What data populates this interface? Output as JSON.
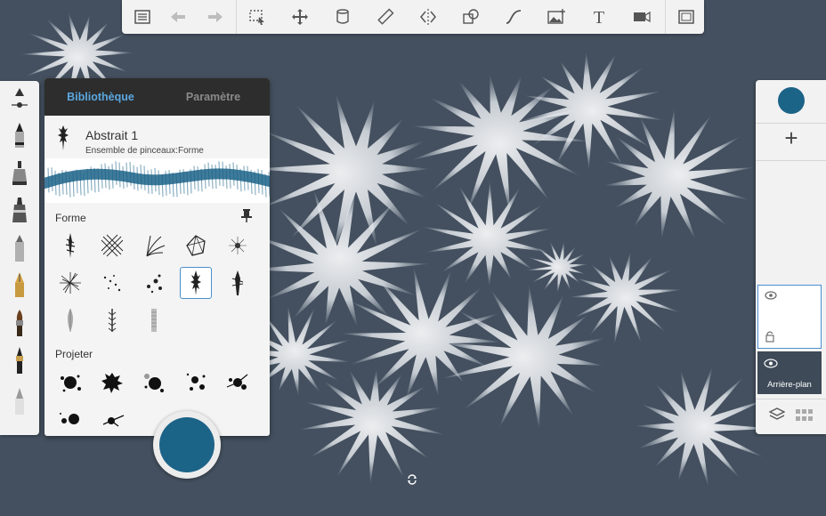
{
  "colors": {
    "canvas_bg": "#44505f",
    "accent_blue": "#1c6388",
    "tab_active": "#5aa7e0",
    "panel_dark": "#2d2d2d",
    "selection": "#4a8fd0"
  },
  "toolbar": {
    "items": [
      {
        "name": "list-icon"
      },
      {
        "name": "undo-icon"
      },
      {
        "name": "redo-icon"
      },
      {
        "name": "selection-icon"
      },
      {
        "name": "transform-icon"
      },
      {
        "name": "fill-bucket-icon"
      },
      {
        "name": "ruler-icon"
      },
      {
        "name": "symmetry-icon"
      },
      {
        "name": "shapes-icon"
      },
      {
        "name": "curve-icon"
      },
      {
        "name": "image-insert-icon"
      },
      {
        "name": "text-icon"
      },
      {
        "name": "video-icon"
      },
      {
        "name": "fullscreen-icon"
      }
    ]
  },
  "brush_panel": {
    "tabs": {
      "library": "Bibliothèque",
      "parameters": "Paramètre"
    },
    "current_brush": {
      "name": "Abstrait 1",
      "set": "Ensemble de pinceaux:Forme"
    },
    "sections": {
      "forme": "Forme",
      "projeter": "Projeter"
    }
  },
  "layers": {
    "background_label": "Arrière-plan"
  }
}
